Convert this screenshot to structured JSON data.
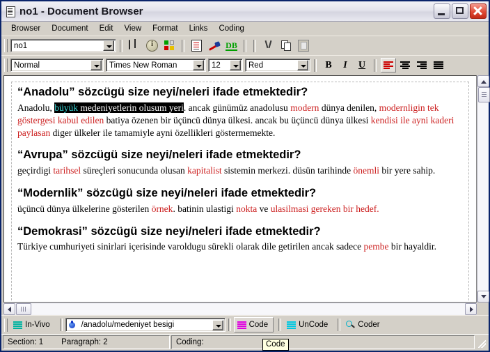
{
  "window": {
    "title": "no1 - Document Browser",
    "icon": "document-icon",
    "buttons": {
      "minimize": "minimize-icon",
      "maximize": "maximize-icon",
      "close": "close-icon"
    }
  },
  "menubar": {
    "items": [
      {
        "label": "Browser"
      },
      {
        "label": "Document"
      },
      {
        "label": "Edit"
      },
      {
        "label": "View"
      },
      {
        "label": "Format"
      },
      {
        "label": "Links"
      },
      {
        "label": "Coding"
      }
    ]
  },
  "toolbar_main": {
    "document_combo": {
      "value": "no1"
    },
    "buttons": [
      {
        "name": "book-icon",
        "tip": "Browse"
      },
      {
        "name": "info-icon",
        "tip": "Properties"
      },
      {
        "name": "color-squares-icon",
        "tip": "Node Explorer"
      },
      {
        "name": "document-edit-icon",
        "tip": "Edit Document"
      },
      {
        "name": "pen-icon",
        "tip": "Annotate"
      },
      {
        "name": "db-icon",
        "tip": "Database"
      },
      {
        "name": "scissors-icon",
        "tip": "Cut"
      },
      {
        "name": "copy-icon",
        "tip": "Copy"
      },
      {
        "name": "paste-icon",
        "tip": "Paste"
      }
    ]
  },
  "toolbar_format": {
    "style_combo": {
      "value": "Normal"
    },
    "font_combo": {
      "value": "Times New Roman"
    },
    "size_combo": {
      "value": "12"
    },
    "color_combo": {
      "value": "Red"
    },
    "bold_label": "B",
    "italic_label": "I",
    "underline_label": "U",
    "align": [
      {
        "name": "align-left-button",
        "selected": true
      },
      {
        "name": "align-center-button",
        "selected": false
      },
      {
        "name": "align-right-button",
        "selected": false
      },
      {
        "name": "align-justify-button",
        "selected": false
      }
    ]
  },
  "document": {
    "sections": [
      {
        "heading": "“Anadolu” sözcügü size neyi/neleri ifade etmektedir?",
        "runs": [
          {
            "text": "Anadolu, ",
            "style": "plain"
          },
          {
            "text": "büyük",
            "style": "selected-teal"
          },
          {
            "text": " medeniyetlerin olusum yeri",
            "style": "selected"
          },
          {
            "text": ". ancak günümüz anadolusu ",
            "style": "plain"
          },
          {
            "text": "modern",
            "style": "red"
          },
          {
            "text": " dünya denilen, ",
            "style": "plain"
          },
          {
            "text": "modernligin tek göstergesi kabul edilen",
            "style": "red"
          },
          {
            "text": " batiya özenen bir üçüncü dünya ülkesi. ancak bu üçüncü dünya ülkesi ",
            "style": "plain"
          },
          {
            "text": "kendisi ile ayni kaderi paylasan",
            "style": "red"
          },
          {
            "text": " diger ülkeler ile tamamiyle ayni özellikleri göstermemekte.",
            "style": "plain"
          }
        ]
      },
      {
        "heading": "“Avrupa” sözcügü size neyi/neleri ifade etmektedir?",
        "runs": [
          {
            "text": "geçirdigi ",
            "style": "plain"
          },
          {
            "text": "tarihsel",
            "style": "red"
          },
          {
            "text": " süreçleri sonucunda olusan ",
            "style": "plain"
          },
          {
            "text": "kapitalist",
            "style": "red"
          },
          {
            "text": " sistemin merkezi. düsün tarihinde ",
            "style": "plain"
          },
          {
            "text": "önemli",
            "style": "red"
          },
          {
            "text": " bir yere sahip.",
            "style": "plain"
          }
        ]
      },
      {
        "heading": "“Modernlik” sözcügü size neyi/neleri ifade etmektedir?",
        "runs": [
          {
            "text": "üçüncü dünya ülkelerine gösterilen ",
            "style": "plain"
          },
          {
            "text": "örnek",
            "style": "red"
          },
          {
            "text": ". batinin ulastigi ",
            "style": "plain"
          },
          {
            "text": "nokta",
            "style": "red"
          },
          {
            "text": " ve ",
            "style": "plain"
          },
          {
            "text": "ulasilmasi gereken bir hedef.",
            "style": "red"
          }
        ]
      },
      {
        "heading": "“Demokrasi” sözcügü size neyi/neleri ifade etmektedir?",
        "runs": [
          {
            "text": "Türkiye cumhuriyeti sinirlari içerisinde varoldugu sürekli olarak dile getirilen ancak sadece ",
            "style": "plain"
          },
          {
            "text": "pembe",
            "style": "red"
          },
          {
            "text": " bir hayaldir.",
            "style": "plain"
          }
        ]
      }
    ]
  },
  "codebar": {
    "invivo_label": "In-Vivo",
    "path_combo": {
      "value": "/anadolu/medeniyet besigi"
    },
    "code_label": "Code",
    "uncode_label": "UnCode",
    "coder_label": "Coder"
  },
  "statusbar": {
    "section_label": "Section: 1",
    "paragraph_label": "Paragraph: 2",
    "coding_label": "Coding:"
  },
  "tooltip": {
    "text": "Code"
  },
  "colors": {
    "titlebar_text": "#16161e",
    "red_text": "#cc2020",
    "selection_bg": "#000000",
    "selection_teal": "#39d6d6",
    "chrome": "#d4d0c8"
  }
}
